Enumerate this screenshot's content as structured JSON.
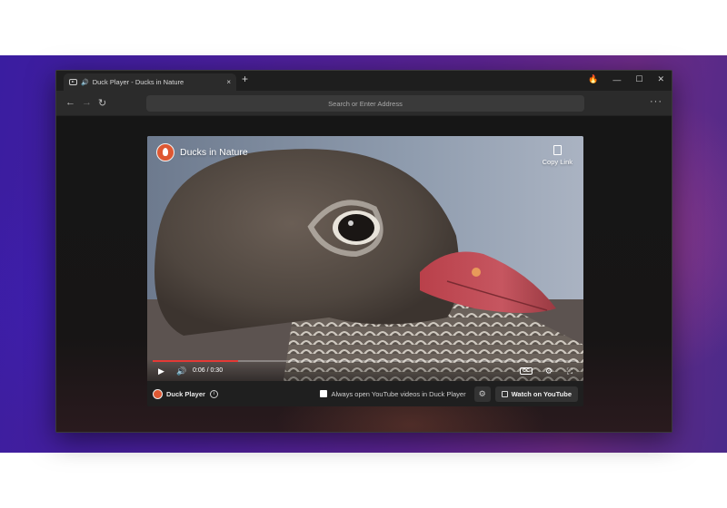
{
  "browser": {
    "tab_title": "Duck Player - Ducks in Nature",
    "tab_close": "×",
    "new_tab": "+",
    "address_placeholder": "Search or Enter Address",
    "menu": "···",
    "controls": {
      "fire": "🔥",
      "minimize": "—",
      "maximize": "☐",
      "close": "✕"
    },
    "nav": {
      "back": "←",
      "forward": "→",
      "reload": "↻"
    }
  },
  "video": {
    "title": "Ducks in Nature",
    "copy_link": "Copy Link",
    "time": "0:06 / 0:30",
    "progress_fraction": 0.2,
    "cc_label": "CC"
  },
  "duck_player": {
    "name": "Duck Player",
    "info": "i",
    "always_open_label": "Always open YouTube videos in Duck Player",
    "always_open_checked": false,
    "watch_on_youtube": "Watch on YouTube"
  }
}
